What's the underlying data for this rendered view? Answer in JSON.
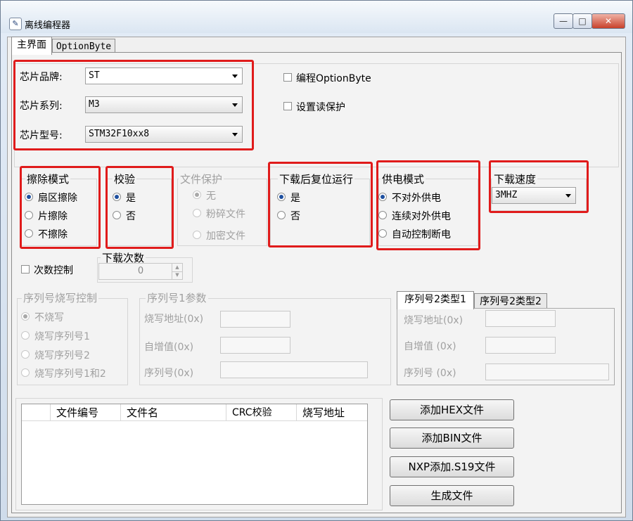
{
  "window": {
    "title": "离线编程器",
    "icon": "app-icon",
    "controls": {
      "minimize": "—",
      "maximize": "□",
      "close": "✕"
    }
  },
  "tabs": {
    "main": "主界面",
    "option_byte": "OptionByte"
  },
  "chip": {
    "brand_label": "芯片品牌:",
    "brand_value": "ST",
    "series_label": "芯片系列:",
    "series_value": "M3",
    "model_label": "芯片型号:",
    "model_value": "STM32F10xx8"
  },
  "options": {
    "program_optionbyte": "编程OptionByte",
    "read_protect": "设置读保护"
  },
  "erase": {
    "title": "擦除模式",
    "items": [
      "扇区擦除",
      "片擦除",
      "不擦除"
    ]
  },
  "verify": {
    "title": "校验",
    "items": [
      "是",
      "否"
    ]
  },
  "file_protect": {
    "title": "文件保护",
    "items": [
      "无",
      "粉碎文件",
      "加密文件"
    ]
  },
  "reset_run": {
    "title": "下载后复位运行",
    "items": [
      "是",
      "否"
    ]
  },
  "power": {
    "title": "供电模式",
    "items": [
      "不对外供电",
      "连续对外供电",
      "自动控制断电"
    ]
  },
  "speed": {
    "title": "下载速度",
    "value": "3MHZ"
  },
  "count": {
    "checkbox_label": "次数控制",
    "title": "下载次数",
    "value": "0",
    "up": "▲",
    "down": "▼"
  },
  "serial_ctrl": {
    "title": "序列号烧写控制",
    "items": [
      "不烧写",
      "烧写序列号1",
      "烧写序列号2",
      "烧写序列号1和2"
    ]
  },
  "serial1": {
    "title": "序列号1参数",
    "addr_label": "烧写地址(0x)",
    "inc_label": "自增值(0x)",
    "serial_label": "序列号(0x)"
  },
  "serial2": {
    "tab1": "序列号2类型1",
    "tab2": "序列号2类型2",
    "addr_label": "烧写地址(0x)",
    "inc_label": "自增值 (0x)",
    "serial_label": "序列号 (0x)"
  },
  "file_list": {
    "columns": [
      "",
      "文件编号",
      "文件名",
      "CRC校验",
      "烧写地址"
    ]
  },
  "buttons": {
    "add_hex": "添加HEX文件",
    "add_bin": "添加BIN文件",
    "add_s19": "NXP添加.S19文件",
    "generate": "生成文件"
  }
}
